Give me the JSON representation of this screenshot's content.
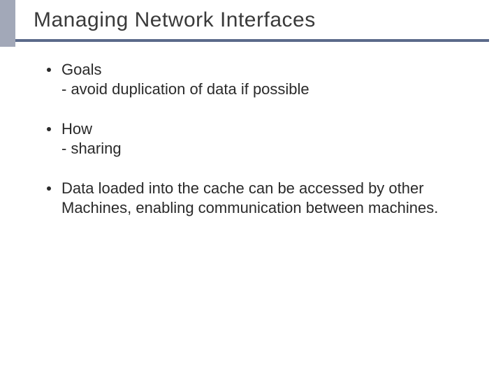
{
  "slide": {
    "title": "Managing Network Interfaces",
    "bullets": [
      "Goals\n- avoid duplication of data if possible",
      "How\n- sharing",
      "Data loaded into the cache can be accessed by other Machines, enabling communication between machines."
    ]
  }
}
